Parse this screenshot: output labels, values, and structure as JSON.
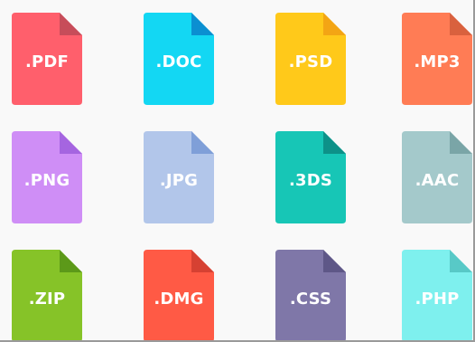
{
  "files": [
    {
      "ext": ".PDF",
      "color": "#ff5f6c",
      "fold": "#c74d5a"
    },
    {
      "ext": ".DOC",
      "color": "#13d7f3",
      "fold": "#0b8fd1"
    },
    {
      "ext": ".PSD",
      "color": "#ffc91a",
      "fold": "#f3a514"
    },
    {
      "ext": ".MP3",
      "color": "#ff7c55",
      "fold": "#d9613e"
    },
    {
      "ext": ".PNG",
      "color": "#cf8ef6",
      "fold": "#a565e0"
    },
    {
      "ext": ".JPG",
      "color": "#b2c6ea",
      "fold": "#7f9fd8"
    },
    {
      "ext": ".3DS",
      "color": "#17c6b6",
      "fold": "#0d9188"
    },
    {
      "ext": ".AAC",
      "color": "#a4c9cb",
      "fold": "#7aa5a7"
    },
    {
      "ext": ".ZIP",
      "color": "#86c328",
      "fold": "#5c9919"
    },
    {
      "ext": ".DMG",
      "color": "#ff5a45",
      "fold": "#d64132"
    },
    {
      "ext": ".CSS",
      "color": "#7f77a8",
      "fold": "#5e5787"
    },
    {
      "ext": ".PHP",
      "color": "#7ef0ee",
      "fold": "#58c9c7"
    }
  ]
}
